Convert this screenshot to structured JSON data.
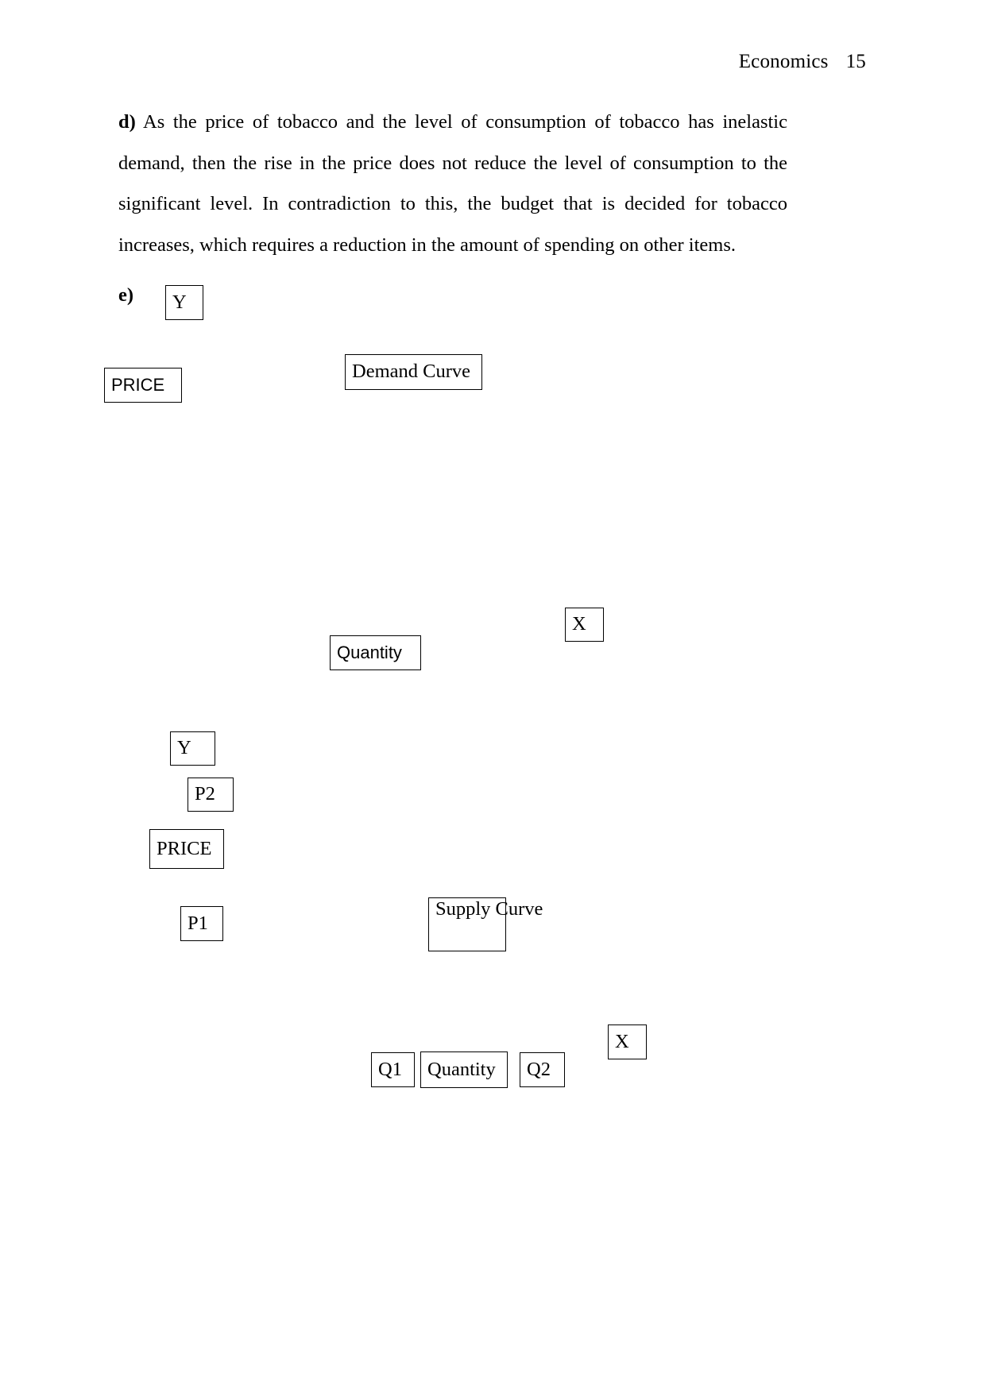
{
  "header": {
    "subject": "Economics",
    "page_number": "15"
  },
  "body": {
    "paragraph_d": "d) As the price of tobacco and the level of consumption of tobacco has inelastic demand, then the rise in the price does not reduce the level of consumption to the significant level. In contradiction to this, the budget that is decided for tobacco increases, which requires a reduction in the amount of spending on other items.",
    "paragraph_d_marker": "d)",
    "paragraph_d_text": " As the price of tobacco and the level of consumption of tobacco has inelastic demand, then the rise in the price does not reduce the level of consumption to the significant level. In contradiction to this, the budget that is decided for tobacco increases, which requires a reduction in the amount of spending on other items.",
    "section_e_marker": "e)"
  },
  "figure_demand": {
    "y_axis_label": "Y",
    "price_axis_label": "PRICE",
    "curve_label": "Demand Curve",
    "x_axis_label": "X",
    "quantity_axis_label": "Quantity"
  },
  "figure_supply": {
    "y_axis_label": "Y",
    "price_high_label": "P2",
    "price_axis_label": "PRICE",
    "price_low_label": "P1",
    "curve_label": "Supply Curve",
    "x_axis_label": "X",
    "quantity_low_label": "Q1",
    "quantity_axis_label": "Quantity",
    "quantity_high_label": "Q2"
  },
  "colors": {
    "page_background": "#ffffff",
    "text": "#000000",
    "box_border": "#000000"
  }
}
